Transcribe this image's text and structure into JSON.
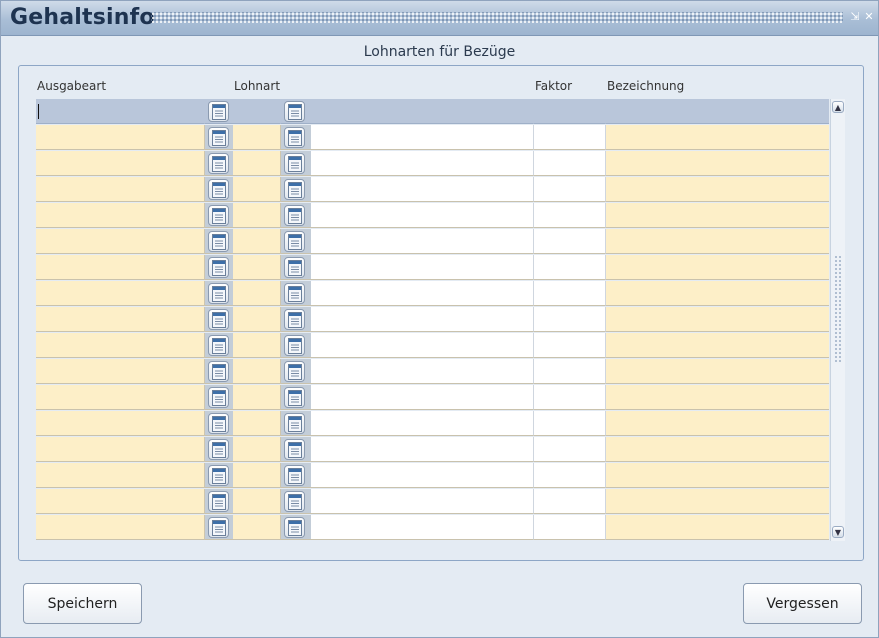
{
  "window": {
    "title": "Gehaltsinfo",
    "minimize_glyph": "⇲",
    "close_glyph": "✕"
  },
  "section": {
    "title": "Lohnarten für Bezüge"
  },
  "table": {
    "columns": {
      "ausgabeart": "Ausgabeart",
      "lohnart": "Lohnart",
      "faktor": "Faktor",
      "bezeichnung": "Bezeichnung"
    },
    "row_count": 17,
    "selected_row": 0,
    "lov_button_icon": "list-of-values-icon"
  },
  "scrollbar": {
    "up_glyph": "▲",
    "down_glyph": "▼"
  },
  "buttons": {
    "save": "Speichern",
    "cancel": "Vergessen"
  },
  "colors": {
    "editable_cell": "#fdefc8",
    "selected_row": "#b9c6da",
    "titlebar": "#a9bed6"
  }
}
